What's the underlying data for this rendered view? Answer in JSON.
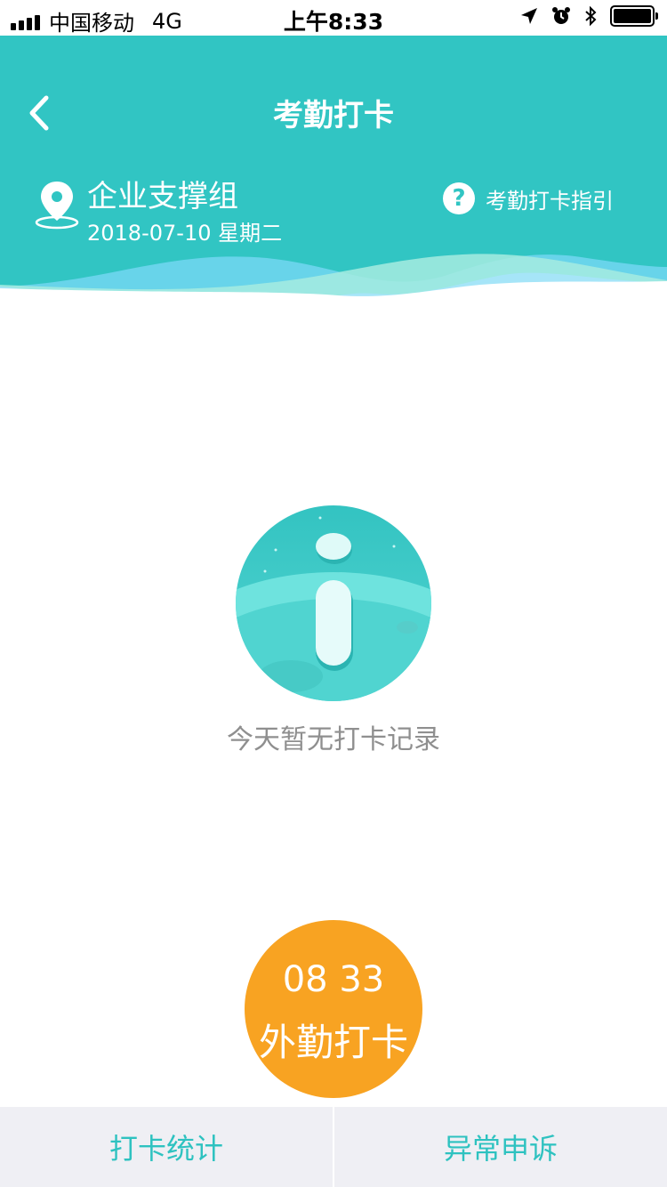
{
  "status_bar": {
    "carrier": "中国移动",
    "network": "4G",
    "time": "上午8:33"
  },
  "header": {
    "title": "考勤打卡",
    "org_name": "企业支撑组",
    "date": "2018-07-10 星期二",
    "guide_label": "考勤打卡指引",
    "guide_icon_glyph": "?"
  },
  "main": {
    "empty_text": "今天暂无打卡记录"
  },
  "punch": {
    "time": "08 33",
    "label": "外勤打卡"
  },
  "bottom_nav": {
    "stats_label": "打卡统计",
    "appeal_label": "异常申诉"
  },
  "colors": {
    "primary": "#31c5c3",
    "accent_orange": "#f8a322",
    "empty_text": "#8f8f8f",
    "bottom_bg": "#efeff4"
  },
  "icons": [
    "back-arrow-icon",
    "location-pin-icon",
    "question-icon",
    "location-arrow-icon",
    "alarm-icon",
    "bluetooth-icon",
    "battery-icon",
    "signal-icon"
  ]
}
